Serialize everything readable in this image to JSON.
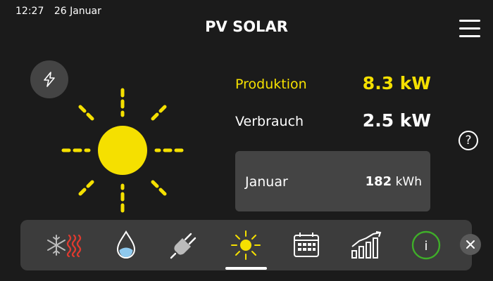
{
  "status": {
    "time": "12:27",
    "date": "26 Januar"
  },
  "header": {
    "title": "PV SOLAR",
    "menu_icon": "hamburger-menu-icon"
  },
  "production": {
    "label": "Produktion",
    "value": "8.3 kW"
  },
  "consumption": {
    "label": "Verbrauch",
    "value": "2.5 kW"
  },
  "month": {
    "name": "Januar",
    "amount": "182",
    "unit": "kWh"
  },
  "help": {
    "symbol": "?"
  },
  "nav": {
    "items": [
      {
        "icon": "heating-cooling-icon"
      },
      {
        "icon": "water-drop-icon"
      },
      {
        "icon": "power-plug-icon"
      },
      {
        "icon": "sun-icon",
        "active": true
      },
      {
        "icon": "calendar-icon"
      },
      {
        "icon": "bar-chart-icon"
      },
      {
        "icon": "info-icon"
      }
    ],
    "info_symbol": "i"
  },
  "colors": {
    "accent": "#f5e000",
    "background": "#1b1b1b",
    "card": "#444444",
    "info_green": "#3fae29"
  }
}
